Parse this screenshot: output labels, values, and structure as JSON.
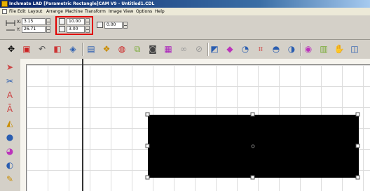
{
  "window": {
    "title": "Inchmate LAD [Parametric Rectangle]CAM V9 - Untitled1.CDL"
  },
  "menus": [
    "File",
    "Edit",
    "Layout",
    "Arrange",
    "Machine",
    "Transform",
    "Image",
    "View",
    "Options",
    "Help"
  ],
  "properties": {
    "position_x": "3.15",
    "position_y": "26.71",
    "width": "10.00",
    "height": "3.00",
    "corner_radius": "0.00"
  },
  "colors": {
    "titlebar": "#0a246a",
    "highlight": "#e00000",
    "shape_fill": "#000000"
  },
  "toolbar_icons": [
    "crosshair-icon",
    "new-icon",
    "undo-icon",
    "shape-icon",
    "layers-icon",
    "book-icon",
    "group-icon",
    "bucket-icon",
    "copy-icon",
    "camera-icon",
    "frame-icon",
    "link-icon",
    "unlink-icon",
    "align-icon",
    "node-icon",
    "select-icon",
    "grid-icon",
    "weld-icon",
    "node-edit-icon",
    "color-icon",
    "chart-icon",
    "hands-icon",
    "map-icon"
  ],
  "left_tools": [
    "arrow-tool-icon",
    "knife-tool-icon",
    "text-tool-icon",
    "text-fit-tool-icon",
    "shape-tool-icon",
    "circle-tool-icon",
    "brush-tool-icon",
    "fill-tool-icon",
    "pencil-tool-icon",
    "zoom-tool-icon"
  ]
}
